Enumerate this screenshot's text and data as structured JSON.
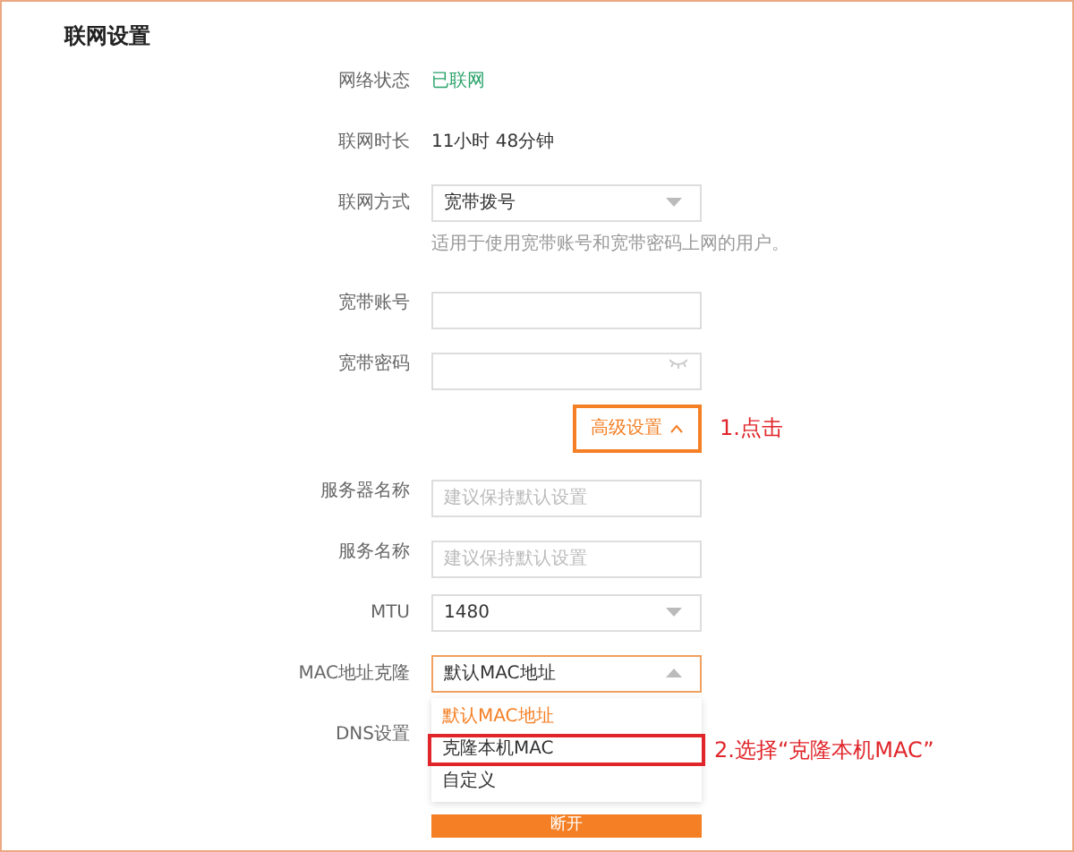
{
  "title": "联网设置",
  "fields": [
    {
      "kind": "text",
      "label": "网络状态",
      "value": "已联网",
      "color": "#2ba36b"
    },
    {
      "kind": "text",
      "label": "联网时长",
      "value": "11小时 48分钟",
      "color": "#333333"
    },
    {
      "kind": "select",
      "label": "联网方式",
      "value": "宽带拨号",
      "expanded": false,
      "hint": "适用于使用宽带账号和宽带密码上网的用户。"
    },
    {
      "kind": "input",
      "label": "宽带账号"
    },
    {
      "kind": "password",
      "label": "宽带密码"
    },
    {
      "kind": "toggle",
      "label": "高级设置",
      "expanded": true,
      "annotated": true,
      "annotation": "1.点击"
    },
    {
      "kind": "input",
      "label": "服务器名称",
      "placeholder": "建议保持默认设置"
    },
    {
      "kind": "input",
      "label": "服务名称",
      "placeholder": "建议保持默认设置"
    },
    {
      "kind": "select",
      "label": "MTU",
      "value": "1480",
      "expanded": false
    },
    {
      "kind": "select",
      "label": "MAC地址克隆",
      "value": "默认MAC地址",
      "expanded": true,
      "annotation": "2.选择“克隆本机MAC”",
      "options": [
        {
          "label": "默认MAC地址",
          "selected": true,
          "annotated": false
        },
        {
          "label": "克隆本机MAC",
          "selected": false,
          "annotated": true
        },
        {
          "label": "自定义",
          "selected": false,
          "annotated": false
        }
      ]
    },
    {
      "kind": "covered",
      "label": "DNS设置"
    },
    {
      "kind": "button",
      "label": "断开"
    }
  ]
}
